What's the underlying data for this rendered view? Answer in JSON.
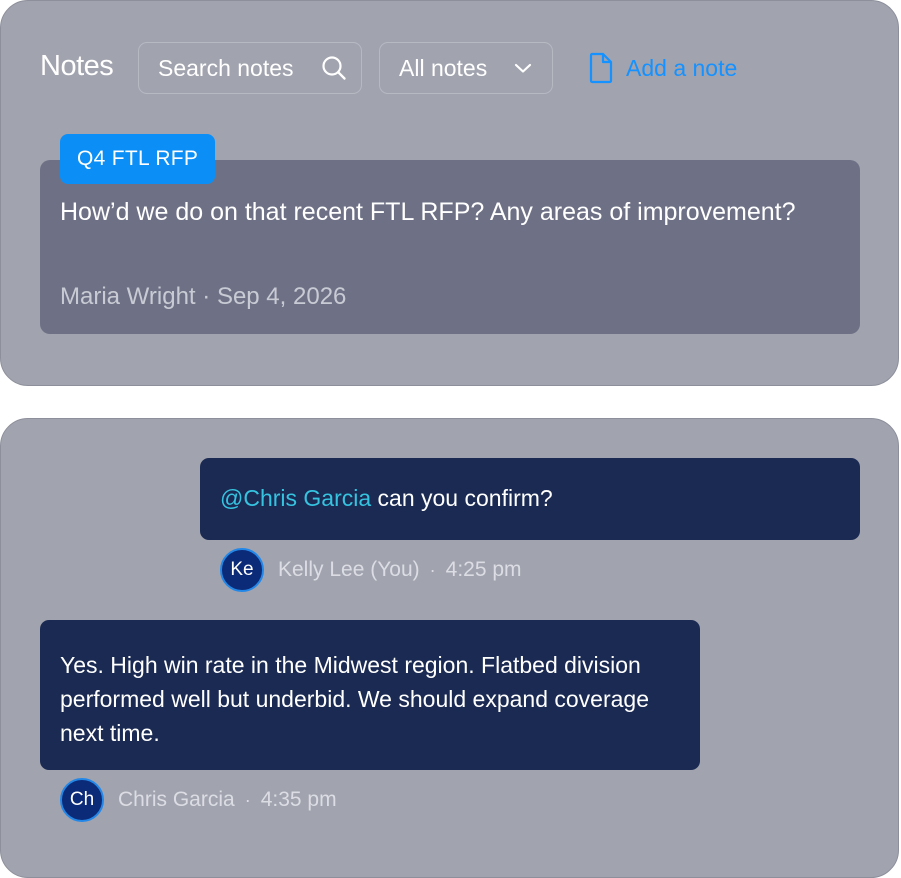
{
  "header": {
    "title": "Notes",
    "search": {
      "placeholder": "Search notes",
      "icon": "search-icon"
    },
    "filter": {
      "selected": "All notes",
      "icon": "chevron-down-icon"
    },
    "add_note": {
      "label": "Add a note",
      "icon": "document-icon"
    }
  },
  "note": {
    "tag": "Q4 FTL RFP",
    "body": "How’d we do on that recent FTL RFP? Any areas of improvement?",
    "author": "Maria Wright",
    "separator": "·",
    "date": "Sep 4, 2026"
  },
  "thread": {
    "messages": [
      {
        "mention": "@Chris Garcia",
        "text": " can you confirm?",
        "avatar_initials": "Ke",
        "author": "Kelly Lee (You)",
        "separator": "·",
        "time": "4:25 pm"
      },
      {
        "text": "Yes. High win rate in the Midwest region. Flatbed division performed well but underbid. We should expand coverage next time.",
        "avatar_initials": "Ch",
        "author": "Chris Garcia",
        "separator": "·",
        "time": "4:35 pm"
      }
    ]
  },
  "colors": {
    "panel_bg": "#a1a3ae",
    "card_bg": "#6e7186",
    "accent_blue": "#1592ff",
    "tag_blue": "#0b8ff7",
    "bubble_bg": "#1a2a52",
    "mention": "#36c3e0",
    "avatar_bg": "#0b2a78"
  }
}
